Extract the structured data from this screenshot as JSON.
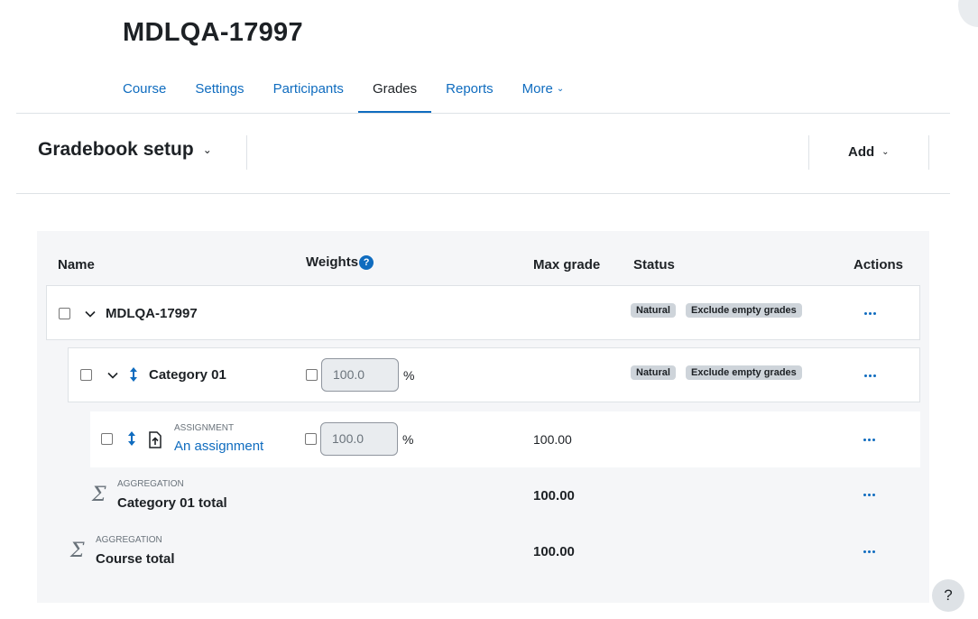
{
  "course": {
    "title": "MDLQA-17997"
  },
  "secnav": {
    "tabs": [
      {
        "label": "Course"
      },
      {
        "label": "Settings"
      },
      {
        "label": "Participants"
      },
      {
        "label": "Grades"
      },
      {
        "label": "Reports"
      },
      {
        "label": "More"
      }
    ],
    "active": "Grades"
  },
  "tertiary": {
    "selector_label": "Gradebook setup",
    "add_label": "Add"
  },
  "table": {
    "headers": {
      "name": "Name",
      "weights": "Weights",
      "max_grade": "Max grade",
      "status": "Status",
      "actions": "Actions"
    },
    "help_glyph": "?",
    "course_row": {
      "name": "MDLQA-17997",
      "badges": [
        "Natural",
        "Exclude empty grades"
      ]
    },
    "category_row": {
      "name": "Category 01",
      "weight": "100.0",
      "unit": "%",
      "badges": [
        "Natural",
        "Exclude empty grades"
      ]
    },
    "item_row": {
      "type": "ASSIGNMENT",
      "name": "An assignment",
      "weight": "100.0",
      "unit": "%",
      "max_grade": "100.00",
      "icon": "assignment-icon"
    },
    "category_total": {
      "type": "AGGREGATION",
      "name": "Category 01 total",
      "max_grade": "100.00"
    },
    "course_total": {
      "type": "AGGREGATION",
      "name": "Course total",
      "max_grade": "100.00"
    },
    "sigma": "Σ"
  },
  "footer": {
    "help": "?"
  },
  "colors": {
    "link": "#0f6cbf",
    "text": "#1d2125",
    "badge": "#ced4da",
    "table_bg": "#f5f6f8"
  }
}
